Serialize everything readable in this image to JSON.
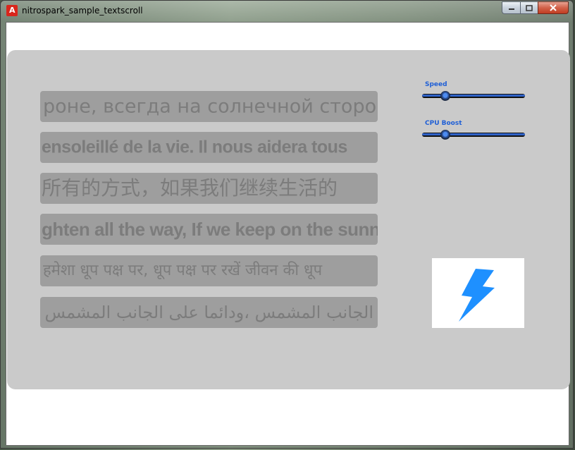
{
  "window": {
    "title": "nitrospark_sample_textscroll",
    "app_icon": "adobe-air-icon",
    "controls": {
      "minimize": "minimize-icon",
      "maximize": "maximize-icon",
      "close": "close-icon"
    }
  },
  "strips": [
    {
      "text": "роне, всегда на солнечной стороне",
      "language": "ru"
    },
    {
      "text": "ensoleillé de la vie. Il nous aidera tous",
      "language": "fr"
    },
    {
      "text": "所有的方式，如果我们继续生活的",
      "language": "zh"
    },
    {
      "text": "ghten all the way, If we keep on the sunny",
      "language": "en"
    },
    {
      "text": "हमेशा धूप पक्ष पर, धूप पक्ष पर रखें जीवन की धूप",
      "language": "hi"
    },
    {
      "text": "الجانب المشمس ،ودائما على الجانب المشمس",
      "language": "ar"
    }
  ],
  "controls": {
    "speed": {
      "label": "Speed",
      "value": 0.2
    },
    "cpu_boost": {
      "label": "CPU Boost",
      "value": 0.2
    }
  },
  "logo": {
    "icon": "lightning-bolt-icon",
    "color": "#1e90ff"
  },
  "colors": {
    "panel": "#cacaca",
    "strip": "#9e9e9e",
    "strip_text": "#7c7c7c",
    "slider_label": "#1f5fd6",
    "slider_fill": "#2f62c8"
  }
}
